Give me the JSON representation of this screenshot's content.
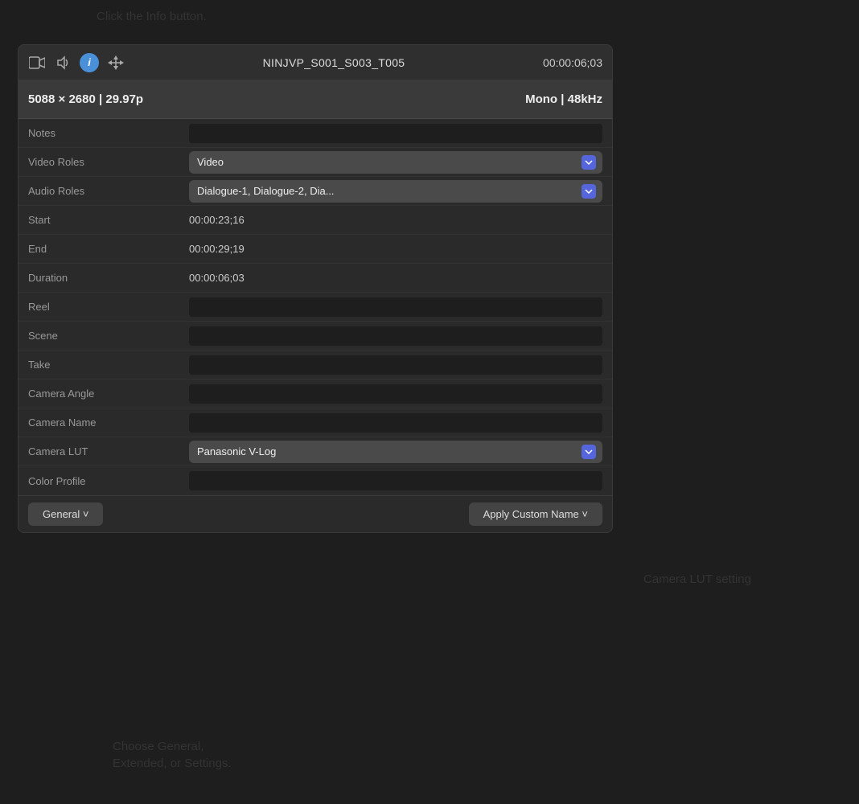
{
  "callout_info": {
    "text": "Click the Info button."
  },
  "callout_general": {
    "text": "Choose General,\nExtended, or Settings."
  },
  "callout_lut": {
    "text": "Camera LUT setting"
  },
  "toolbar": {
    "title": "NINJVP_S001_S003_T005",
    "timecode": "00:00:06;03",
    "video_icon": "▦",
    "audio_icon": "♪",
    "info_icon": "i",
    "transform_icon": "⇔"
  },
  "info_bar": {
    "resolution": "5088 × 2680",
    "framerate": "29.97p",
    "audio_type": "Mono",
    "sample_rate": "48kHz"
  },
  "properties": [
    {
      "label": "Notes",
      "type": "input",
      "value": ""
    },
    {
      "label": "Video Roles",
      "type": "select",
      "value": "Video",
      "options": [
        "Video"
      ]
    },
    {
      "label": "Audio Roles",
      "type": "select",
      "value": "Dialogue-1, Dialogue-2, Dia...",
      "options": [
        "Dialogue-1, Dialogue-2, Dia..."
      ]
    },
    {
      "label": "Start",
      "type": "text",
      "value": "00:00:23;16"
    },
    {
      "label": "End",
      "type": "text",
      "value": "00:00:29;19"
    },
    {
      "label": "Duration",
      "type": "text",
      "value": "00:00:06;03"
    },
    {
      "label": "Reel",
      "type": "input",
      "value": ""
    },
    {
      "label": "Scene",
      "type": "input",
      "value": ""
    },
    {
      "label": "Take",
      "type": "input",
      "value": ""
    },
    {
      "label": "Camera Angle",
      "type": "input",
      "value": ""
    },
    {
      "label": "Camera Name",
      "type": "input",
      "value": ""
    },
    {
      "label": "Camera LUT",
      "type": "select",
      "value": "Panasonic V-Log",
      "options": [
        "Panasonic V-Log"
      ]
    },
    {
      "label": "Color Profile",
      "type": "input",
      "value": ""
    }
  ],
  "action_bar": {
    "left_btn": "General ˅",
    "right_btn": "Apply Custom Name ˅"
  }
}
